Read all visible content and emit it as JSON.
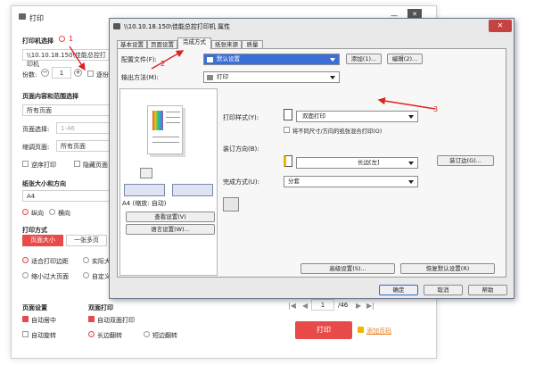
{
  "print_window": {
    "title": "打印",
    "printer_section": "打印机选择",
    "printer_value": "\\\\10.10.18.150\\佳能总控打印机",
    "copies_label": "份数:",
    "copies_value": "1",
    "collate_label": "逐份",
    "range_section": "页面内容和范围选择",
    "range_value": "所有页面",
    "pages_label": "页面选择:",
    "pages_placeholder": "1-46",
    "page_order_label": "缩调页面:",
    "page_order_value": "所有页面",
    "reverse_label": "逆序打印",
    "hide_label": "隐藏页面",
    "paper_section": "纸张大小和方向",
    "paper_value": "A4",
    "portrait_label": "纵向",
    "landscape_label": "横向",
    "mode_section": "打印方式",
    "btn_page_size": "页面大小",
    "btn_multi": "一张多页",
    "fit_label": "适合打印边距",
    "actual_label": "实际大",
    "shrink_label": "缩小过大页面",
    "custom_label": "自定义",
    "page_settings_section": "页面设置",
    "center_label": "自动居中",
    "rotate_label": "自动旋转",
    "duplex_section": "双面打印",
    "auto_duplex_label": "自动双面打印",
    "long_edge_label": "长边翻转",
    "short_edge_label": "短边翻转",
    "page_nav_value": "1",
    "page_nav_total": "/46",
    "print_button": "打印",
    "add_page_label": "添加页码",
    "minimize": "—",
    "close": "✕"
  },
  "dialog": {
    "title": "\\\\10.10.18.150\\佳能总控打印机 属性",
    "tabs": [
      "基本设置",
      "页面设置",
      "完成方式",
      "纸张来源",
      "质量"
    ],
    "active_tab": 2,
    "profile_label": "配置文件(F):",
    "profile_value": "默认设置",
    "add_button": "添加(1)...",
    "edit_button": "编辑(2)...",
    "output_label": "输出方法(M):",
    "output_value": "打印",
    "print_style_label": "打印样式(Y):",
    "print_style_value": "双面打印",
    "mixed_label": "将不同尺寸/方向的纸张混合打印(O)",
    "binding_label": "装订方向(B):",
    "binding_value": "长边[左]",
    "gutter_button": "装订边(G)...",
    "finishing_label": "完成方式(U):",
    "finishing_value": "分套",
    "preview_caption": "A4 (缩放: 自动)",
    "view_settings_button": "查看设置(V)",
    "language_button": "语言设置(W)...",
    "advanced_button": "高级设置(S)...",
    "restore_button": "恢复默认设置(R)",
    "ok_button": "确定",
    "cancel_button": "取消",
    "help_button": "帮助",
    "close": "✕"
  },
  "annotations": [
    "1",
    "2",
    "3"
  ],
  "colors": {
    "accent_red": "#e84a4a",
    "annot_red": "#d22222",
    "dialog_border": "#6b7a8f"
  }
}
